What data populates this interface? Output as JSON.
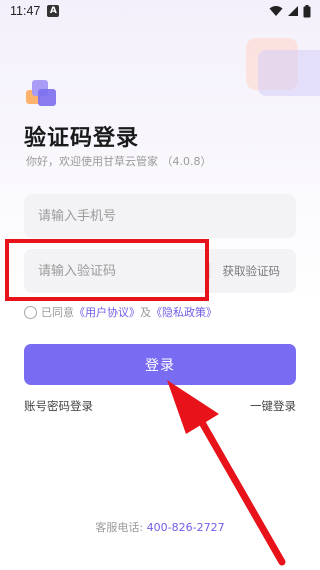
{
  "status_bar": {
    "time": "11:47",
    "a_badge": "A"
  },
  "header": {
    "title": "验证码登录",
    "subtitle": "你好，欢迎使用甘草云管家 （4.0.8）"
  },
  "form": {
    "phone_placeholder": "请输入手机号",
    "code_placeholder": "请输入验证码",
    "get_code_label": "获取验证码"
  },
  "agreement": {
    "prefix": "已同意",
    "user_agreement": "《用户协议》",
    "and": "及",
    "privacy_policy": "《隐私政策》",
    "checked": false
  },
  "actions": {
    "login_label": "登录",
    "password_login": "账号密码登录",
    "one_click_login": "一键登录"
  },
  "footer": {
    "label": "客服电话:",
    "phone": "400-826-2727"
  },
  "colors": {
    "accent": "#7a6cf2",
    "link": "#6f5fe6",
    "annotation": "#e8121a",
    "logo_orange": "#ffb26b",
    "logo_purple": "#8b7ff0"
  },
  "icons": [
    "a-notification-icon",
    "wifi-icon",
    "signal-icon",
    "battery-icon",
    "app-logo-icon",
    "radio-unchecked-icon"
  ]
}
